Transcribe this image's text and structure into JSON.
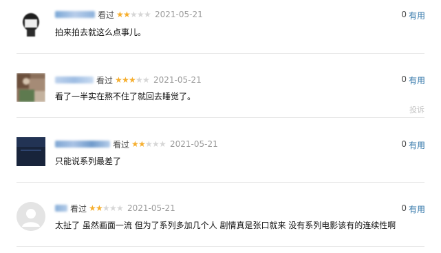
{
  "comments": [
    {
      "seen": "看过",
      "rating": 2,
      "date": "2021-05-21",
      "text": "拍来拍去就这么点事儿。",
      "useful_count": "0",
      "useful_label": "有用"
    },
    {
      "seen": "看过",
      "rating": 3,
      "date": "2021-05-21",
      "text": "看了一半实在熬不住了就回去睡觉了。",
      "useful_count": "0",
      "useful_label": "有用",
      "report": "投诉"
    },
    {
      "seen": "看过",
      "rating": 2,
      "date": "2021-05-21",
      "text": "只能说系列最差了",
      "useful_count": "0",
      "useful_label": "有用"
    },
    {
      "seen": "看过",
      "rating": 2,
      "date": "2021-05-21",
      "text": "太扯了 虽然画面一流 但为了系列多加几个人 剧情真是张口就来 没有系列电影该有的连续性啊",
      "useful_count": "0",
      "useful_label": "有用"
    }
  ],
  "star_glyph": "★",
  "colors": {
    "star_on": "#f6ae2d",
    "star_off": "#d6d6d6",
    "link": "#3377aa"
  }
}
